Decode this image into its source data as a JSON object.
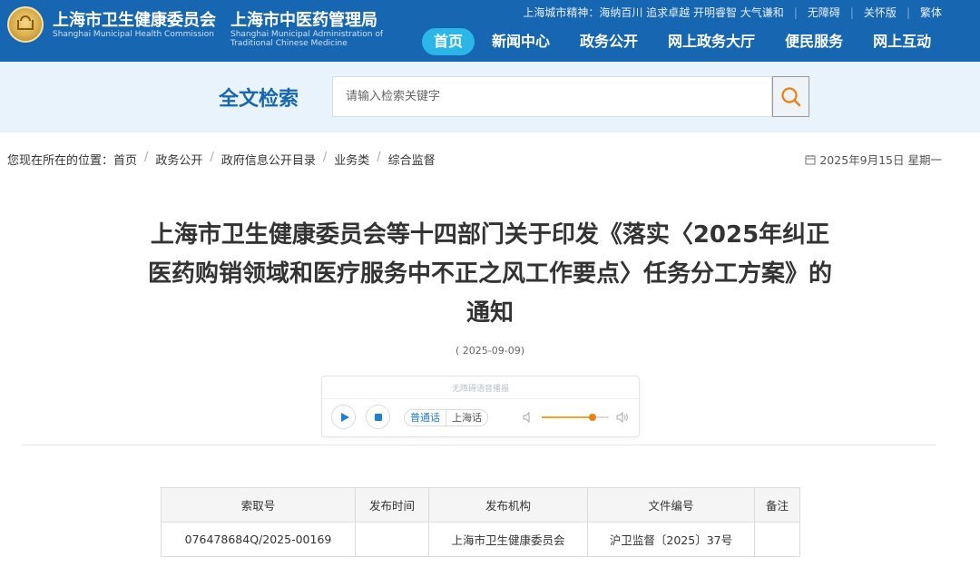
{
  "header": {
    "org_cn_1": "上海市卫生健康委员会",
    "org_en_1": "Shanghai Municipal Health Commission",
    "org_cn_2": "上海市中医药管理局",
    "org_en_2_line1": "Shanghai Municipal Administration of",
    "org_en_2_line2": "Traditional Chinese Medicine",
    "slogan": "上海城市精神：海纳百川 追求卓越 开明睿智 大气谦和",
    "links": [
      "无障碍",
      "关怀版",
      "繁体"
    ],
    "nav": [
      "首页",
      "新闻中心",
      "政务公开",
      "网上政务大厅",
      "便民服务",
      "网上互动"
    ],
    "nav_active": "首页",
    "colors": {
      "header_bg": "#1766b2",
      "nav_active_bg": "#2ab7e8"
    }
  },
  "search": {
    "title": "全文检索",
    "placeholder": "请输入检索关键字",
    "button_icon": "search-icon"
  },
  "breadcrumb": {
    "prefix": "您现在所在的位置：",
    "items": [
      "首页",
      "政务公开",
      "政府信息公开目录",
      "业务类",
      "综合监督"
    ]
  },
  "date": "2025年9月15日 星期一",
  "article": {
    "title_line1": "上海市卫生健康委员会等十四部门关于印发《落实〈2025年纠正",
    "title_line2": "医药购销领域和医疗服务中不正之风工作要点〉任务分工方案》的",
    "title_line3": "通知",
    "pubdate": "( 2025-09-09)"
  },
  "player": {
    "caption": "无障碍语音播报",
    "lang_on": "普通话",
    "lang_off": "上海话",
    "volume": 0.75
  },
  "info_table": {
    "headers": [
      "索取号",
      "发布时间",
      "发布机构",
      "文件编号",
      "备注"
    ],
    "row": [
      "076478684Q/2025-00169",
      "",
      "上海市卫生健康委员会",
      "沪卫监督〔2025〕37号",
      ""
    ]
  }
}
